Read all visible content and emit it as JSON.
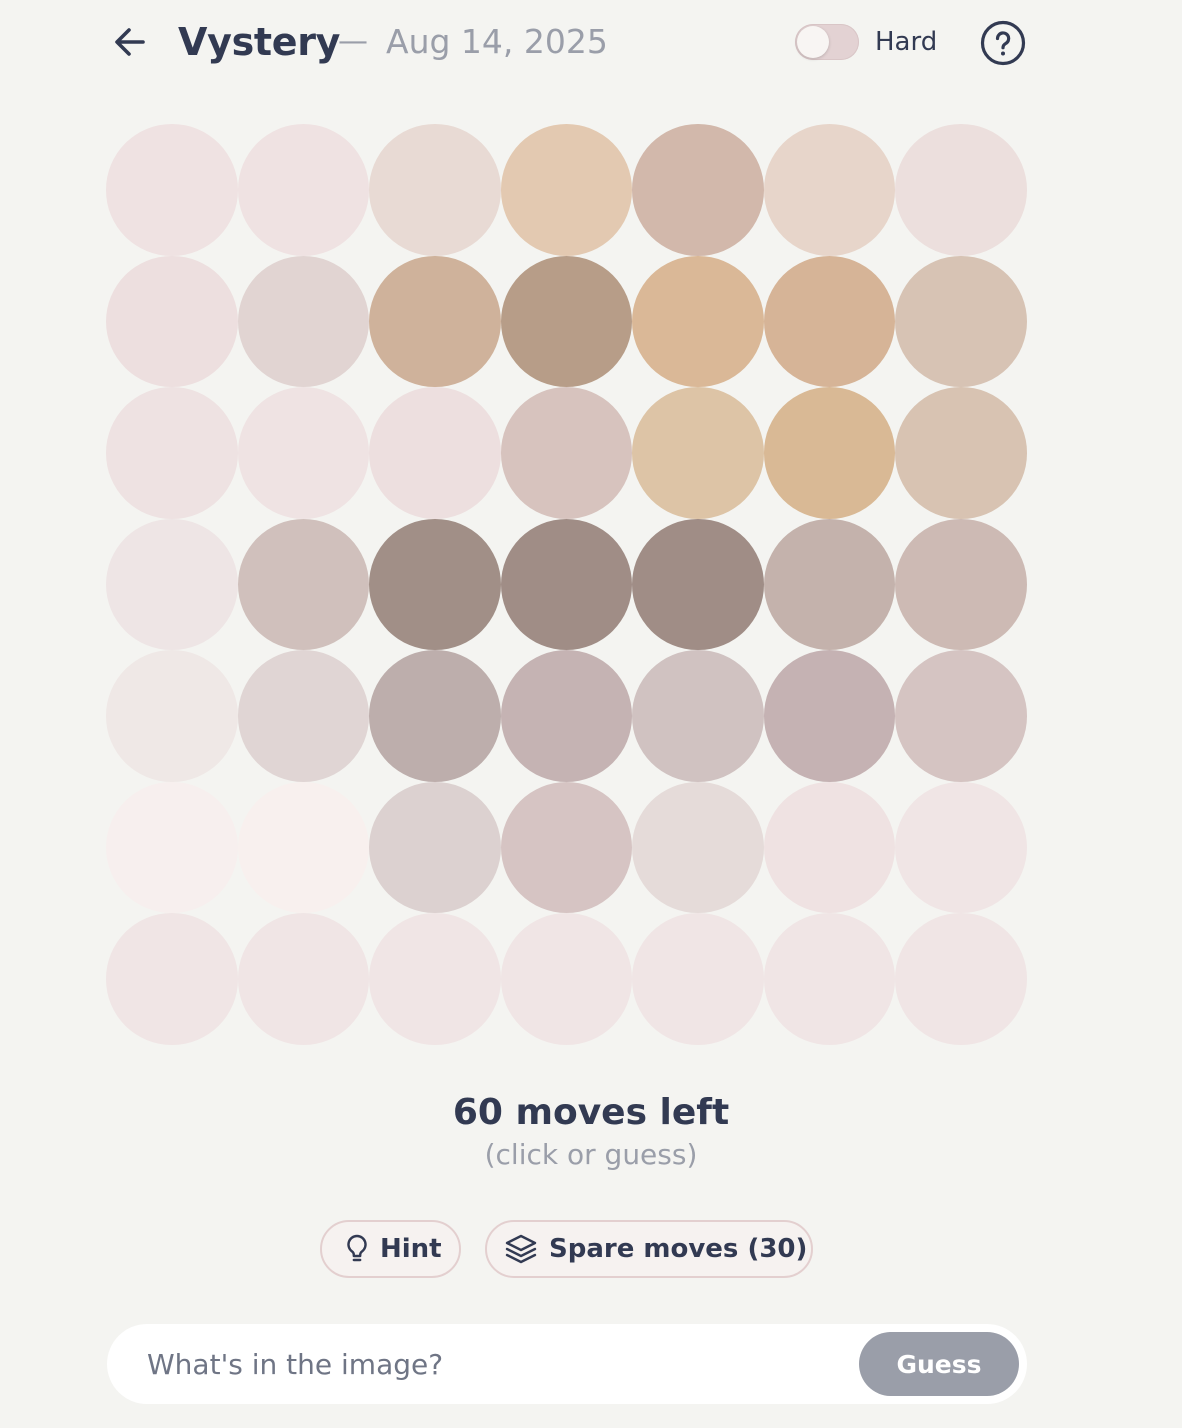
{
  "header": {
    "back_icon": "arrow-left-icon",
    "title": "Vystery",
    "separator": "—",
    "date": "Aug 14, 2025",
    "hard_mode_label": "Hard",
    "hard_mode_enabled": false,
    "help_icon": "question-circle-icon"
  },
  "grid": {
    "rows": 7,
    "cols": 7,
    "colors": [
      [
        "#efe2e2",
        "#efe2e2",
        "#e8dad4",
        "#e3c9b1",
        "#d2b8ab",
        "#e7d5ca",
        "#ecdfdd"
      ],
      [
        "#eddfdf",
        "#e1d4d2",
        "#cfb29b",
        "#b79d88",
        "#dab897",
        "#d6b497",
        "#d7c3b4"
      ],
      [
        "#eee2e2",
        "#efe3e3",
        "#eddfdf",
        "#d7c3be",
        "#ddc4a6",
        "#d9b995",
        "#d8c3b2"
      ],
      [
        "#eee5e5",
        "#d0c0bc",
        "#a18f87",
        "#a08d86",
        "#a08d86",
        "#c4b2ac",
        "#cdbab4"
      ],
      [
        "#efe8e6",
        "#e0d5d4",
        "#bdaeac",
        "#c5b3b3",
        "#d0c2c1",
        "#c5b2b3",
        "#d5c4c2"
      ],
      [
        "#f7efee",
        "#f8f0ee",
        "#dcd1d0",
        "#d6c4c3",
        "#e5dbd9",
        "#efe2e2",
        "#f0e5e5"
      ],
      [
        "#f0e5e5",
        "#f0e5e5",
        "#f0e5e5",
        "#f0e5e5",
        "#f0e5e5",
        "#f0e5e5",
        "#f0e5e5"
      ]
    ]
  },
  "moves": {
    "count_text": "60 moves left",
    "subtitle": "(click or guess)"
  },
  "actions": {
    "hint_icon": "lightbulb-icon",
    "hint_label": "Hint",
    "spare_icon": "layers-icon",
    "spare_label": "Spare moves (30)"
  },
  "guess": {
    "placeholder": "What's in the image?",
    "value": "",
    "button_label": "Guess"
  }
}
